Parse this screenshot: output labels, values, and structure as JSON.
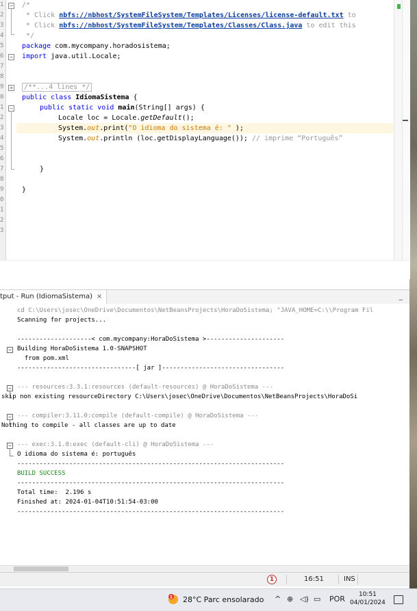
{
  "editor": {
    "line_numbers": [
      "1",
      "2",
      "3",
      "4",
      "5",
      "6",
      "7",
      "8",
      "9",
      "0",
      "1",
      "2",
      "3",
      "4",
      "5",
      "6",
      "7",
      "8",
      "9",
      "0",
      "1",
      "2",
      "3"
    ],
    "lines": {
      "l1": "/*",
      "l2_pre": " * Click ",
      "l2_link": "nbfs://nbhost/SystemFileSystem/Templates/Licenses/license-default.txt",
      "l2_post": " to",
      "l3_pre": " * Click ",
      "l3_link": "nbfs://nbhost/SystemFileSystem/Templates/Classes/Class.java",
      "l3_post": " to edit this",
      "l4": " */",
      "l5_kw": "package",
      "l5_rest": " com.mycompany.horadosistema;",
      "l6_kw": "import",
      "l6_rest": " java.util.Locale;",
      "l9_fold": "/**...4 lines */",
      "l10_kw": "public class",
      "l10_name": "IdiomaSistema",
      "l10_rest": " {",
      "l11_kw": "public static void",
      "l11_name": "main",
      "l11_rest": "(String[] args) {",
      "l12_pre": "Locale loc = Locale.",
      "l12_method": "getDefault",
      "l12_post": "();",
      "l13_pre": "System.",
      "l13_out": "out",
      "l13_mid": ".print(",
      "l13_str": "\"O idioma do sistema é: \"",
      "l13_post": " );",
      "l14_pre": "System.",
      "l14_out": "out",
      "l14_mid": ".println (loc.getDisplayLanguage()); ",
      "l14_cmt": "// imprime “Português”",
      "l17": "}",
      "l20": "}"
    }
  },
  "output_tab": {
    "label": "tput - Run (IdiomaSistema)",
    "close": "×",
    "minimize": "_"
  },
  "output": {
    "cmd": "cd C:\\Users\\josec\\OneDrive\\Documentos\\NetBeansProjects\\HoraDoSistema; \"JAVA_HOME=C:\\\\Program Fil",
    "scanning": "Scanning for projects...",
    "sep_project": "--------------------< com.mycompany:HoraDoSistema >---------------------",
    "building": "Building HoraDoSistema 1.0-SNAPSHOT",
    "from_pom": "  from pom.xml",
    "sep_jar": "--------------------------------[ jar ]---------------------------------",
    "resources": "--- resources:3.3.1:resources (default-resources) @ HoraDoSistema ---",
    "skip": "skip non existing resourceDirectory C:\\Users\\josec\\OneDrive\\Documentos\\NetBeansProjects\\HoraDoSi",
    "compiler": "--- compiler:3.11.0:compile (default-compile) @ HoraDoSistema ---",
    "nothing": "Nothing to compile - all classes are up to date",
    "exec": "--- exec:3.1.0:exec (default-cli) @ HoraDoSistema ---",
    "result": "O idioma do sistema é: português",
    "sep": "------------------------------------------------------------------------",
    "build_success": "BUILD SUCCESS",
    "total_time": "Total time:  2.196 s",
    "finished": "Finished at: 2024-01-04T10:51:54-03:00"
  },
  "status": {
    "warning_icon": "1",
    "position": "16:51",
    "mode": "INS"
  },
  "taskbar": {
    "weather": "28°C  Parc ensolarado",
    "language": "POR",
    "time": "10:51",
    "date": "04/01/2024",
    "tray_chevron": "^",
    "weather_badge": "1"
  },
  "colors": {
    "keyword": "#0000e6",
    "comment": "#969696",
    "string": "#ce7b00",
    "success": "#1a8a1a",
    "current_line": "#fdf7e2"
  }
}
